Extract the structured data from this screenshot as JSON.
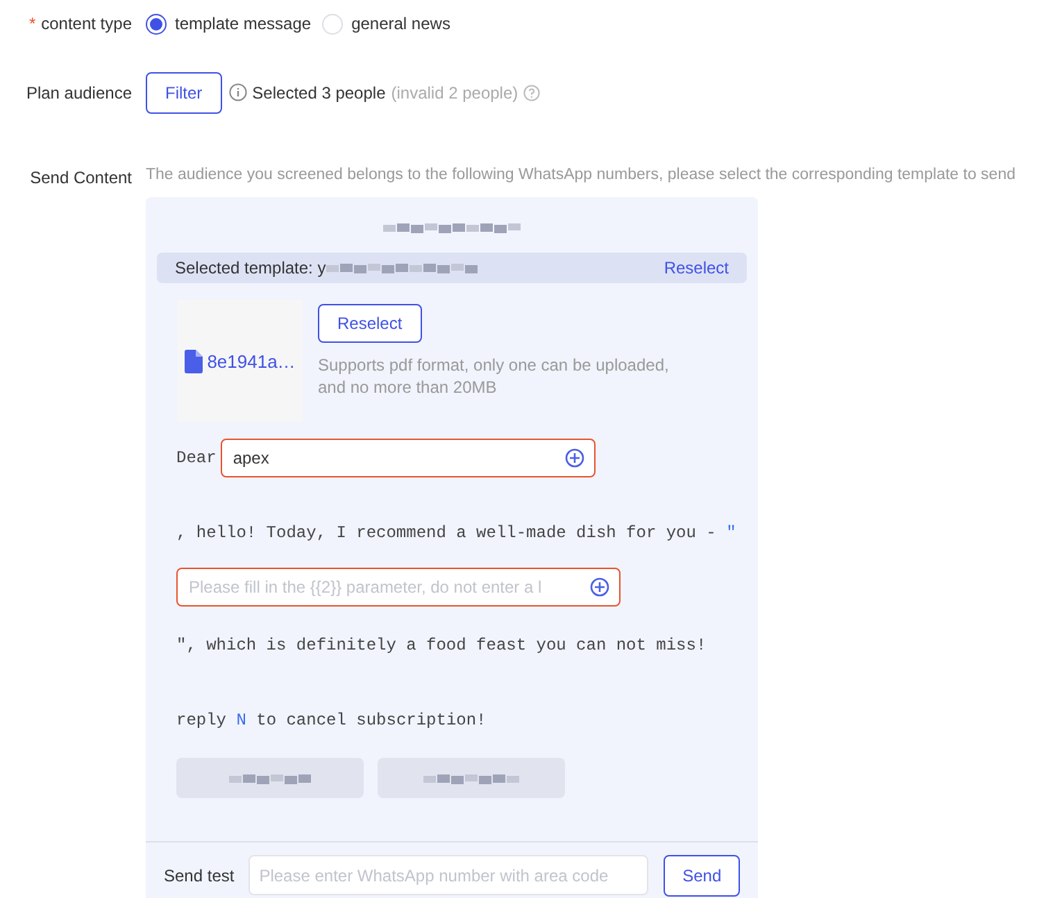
{
  "content_type": {
    "label": "content type",
    "required_mark": "*",
    "options": [
      {
        "label": "template message",
        "selected": true
      },
      {
        "label": "general news",
        "selected": false
      }
    ]
  },
  "plan_audience": {
    "label": "Plan audience",
    "button": "Filter",
    "summary": "Selected 3 people",
    "invalid": "(invalid 2 people)"
  },
  "send_content": {
    "label": "Send Content",
    "hint": "The audience you screened belongs to the following WhatsApp numbers, please select the corresponding template to send",
    "selected_template": {
      "label": "Selected template: y",
      "action": "Reselect"
    },
    "attachment": {
      "file_name": "8e1941a…",
      "button": "Reselect",
      "note": "Supports pdf format, only one can be uploaded, and no more than 20MB"
    },
    "body": [
      {
        "kind": "text",
        "segments": [
          {
            "text": "Dear",
            "variable": false
          }
        ]
      },
      {
        "kind": "field",
        "value": "apex",
        "invalid": true
      },
      {
        "kind": "text",
        "segments": [
          {
            "text": ", hello! Today, I recommend a well-made dish for you - ",
            "variable": false
          },
          {
            "text": "\"",
            "variable": true
          }
        ]
      },
      {
        "kind": "field",
        "placeholder": "Please fill in the {{2}} parameter, do not enter a l",
        "invalid": true
      },
      {
        "kind": "text",
        "segments": [
          {
            "text": "\", which is definitely a food feast you can not miss!",
            "variable": false
          }
        ]
      },
      {
        "kind": "text",
        "segments": [
          {
            "text": "reply ",
            "variable": false
          },
          {
            "text": "N",
            "variable": true
          },
          {
            "text": " to cancel subscription!",
            "variable": false
          }
        ]
      }
    ]
  },
  "send_test": {
    "label": "Send test",
    "placeholder": "Please enter WhatsApp number with area code",
    "button": "Send"
  }
}
